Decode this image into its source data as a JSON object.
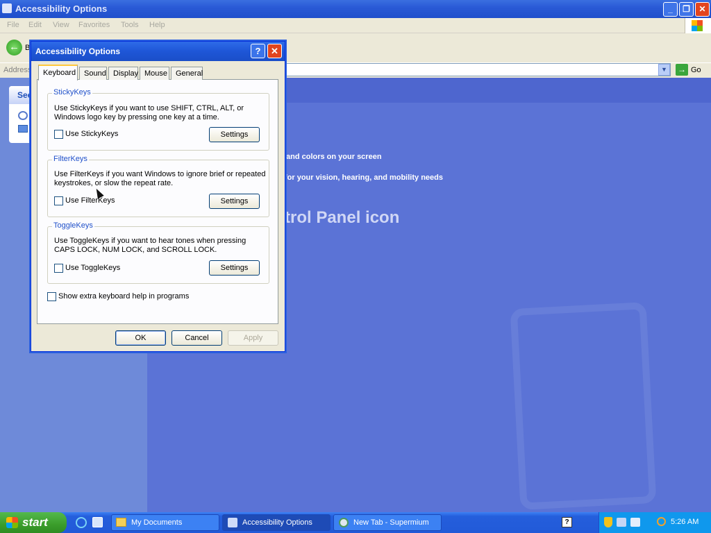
{
  "window": {
    "title": "Accessibility Options",
    "min": "_",
    "max": "❐",
    "close": "✕"
  },
  "menu": [
    "File",
    "Edit",
    "View",
    "Favorites",
    "Tools",
    "Help"
  ],
  "toolbar": {
    "back_label": "B"
  },
  "address": {
    "label": "Address",
    "go_label": "Go"
  },
  "sidebar": {
    "see_label": "See"
  },
  "content": {
    "line1": "and colors on your screen",
    "line2": "for your vision, hearing, and mobility needs",
    "big_text": "trol Panel icon"
  },
  "dialog": {
    "title": "Accessibility Options",
    "help": "?",
    "close": "✕",
    "tabs": [
      "Keyboard",
      "Sound",
      "Display",
      "Mouse",
      "General"
    ],
    "groups": [
      {
        "title": "StickyKeys",
        "desc1": "Use StickyKeys if you want to use SHIFT, CTRL, ALT, or",
        "desc2": "Windows logo key by pressing one key at a time.",
        "check": "Use StickyKeys",
        "button": "Settings"
      },
      {
        "title": "FilterKeys",
        "desc1": "Use FilterKeys if you want Windows to ignore brief or repeated",
        "desc2": "keystrokes, or slow the repeat rate.",
        "check": "Use FilterKeys",
        "button": "Settings"
      },
      {
        "title": "ToggleKeys",
        "desc1": "Use ToggleKeys if you want to hear tones when pressing",
        "desc2": "CAPS LOCK, NUM LOCK, and SCROLL LOCK.",
        "check": "Use ToggleKeys",
        "button": "Settings"
      }
    ],
    "extra_help": "Show extra keyboard help in programs",
    "ok": "OK",
    "cancel": "Cancel",
    "apply": "Apply"
  },
  "taskbar": {
    "start": "start",
    "tasks": [
      "My Documents",
      "Accessibility Options",
      "New Tab - Supermium"
    ],
    "clock": "5:26 AM"
  },
  "colors": {
    "xp_blue": "#245edc",
    "dialog_bg": "#ece9d8",
    "group_title": "#1f50c9",
    "desktop": "#5b73d6"
  }
}
